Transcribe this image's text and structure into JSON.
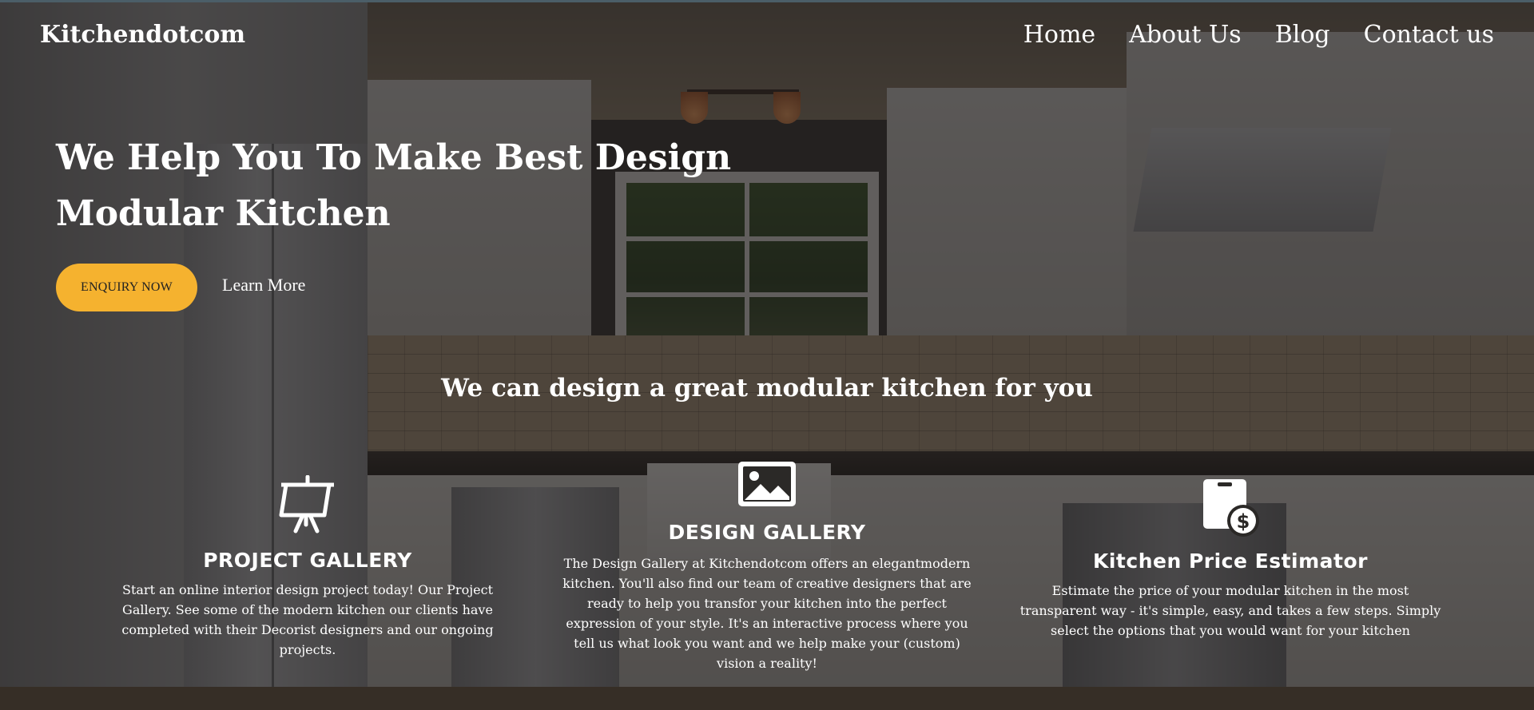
{
  "brand": {
    "name": "Kitchendotcom"
  },
  "nav": {
    "items": [
      {
        "label": "Home"
      },
      {
        "label": "About Us"
      },
      {
        "label": "Blog"
      },
      {
        "label": "Contact us"
      }
    ]
  },
  "hero": {
    "title": "We Help You To Make Best Design Modular Kitchen",
    "cta_label": "ENQUIRY NOW",
    "learn_more_label": "Learn More"
  },
  "tagline": "We can design a great modular kitchen for you",
  "features": [
    {
      "icon": "presentation-board-icon",
      "title": "PROJECT GALLERY",
      "text": "Start an online interior design project today! Our Project Gallery. See some of the modern kitchen our clients have completed with their Decorist designers and our ongoing projects."
    },
    {
      "icon": "image-icon",
      "title": "DESIGN GALLERY",
      "text": "The Design Gallery at Kitchendotcom offers an elegantmodern kitchen. You'll also find our team of creative designers that are ready to help you transfor your kitchen into the perfect expression of your style. It's an interactive process where you tell us what look you want and we help make your (custom) vision a reality!"
    },
    {
      "icon": "price-tag-dollar-icon",
      "title": "Kitchen Price Estimator",
      "text": "Estimate the price of your modular kitchen in the most transparent way - it's simple, easy, and takes a few steps. Simply select the options that you would want for your kitchen"
    }
  ],
  "colors": {
    "accent": "#f5b22f",
    "overlay": "#161413",
    "text": "#ffffff"
  }
}
